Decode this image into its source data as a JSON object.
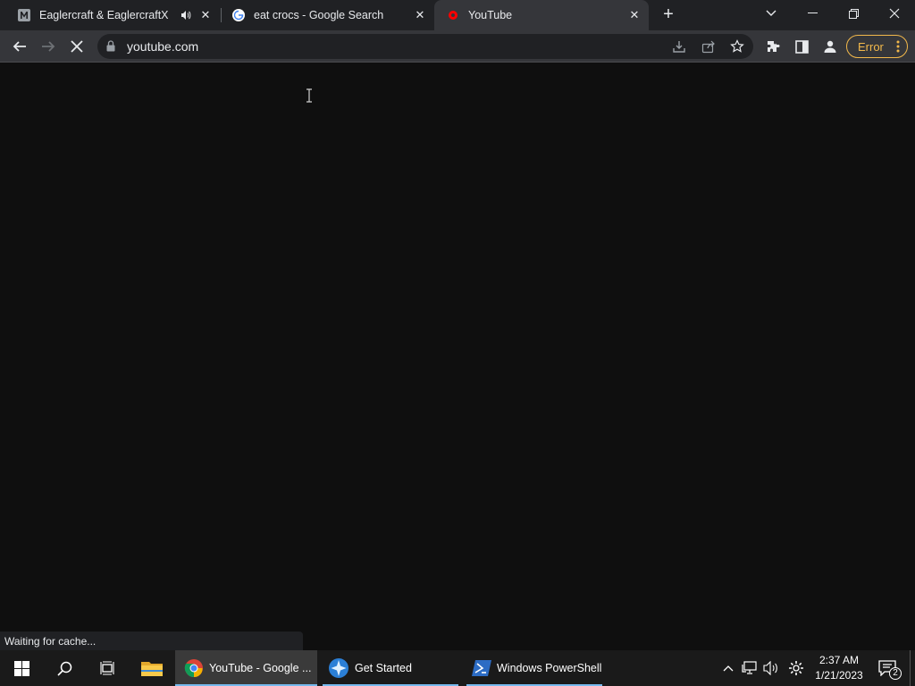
{
  "tabs": [
    {
      "title": "Eaglercraft & EaglercraftX",
      "favicon": "m-logo-icon",
      "audio": true,
      "active": false
    },
    {
      "title": "eat crocs - Google Search",
      "favicon": "google-g-icon",
      "audio": false,
      "active": false
    },
    {
      "title": "YouTube",
      "favicon": "youtube-icon",
      "audio": false,
      "active": true
    }
  ],
  "omnibox": {
    "url": "youtube.com"
  },
  "toolbar": {
    "error_label": "Error"
  },
  "status_text": "Waiting for cache...",
  "taskbar": {
    "items": [
      {
        "label": "YouTube - Google ...",
        "icon": "chrome-icon",
        "active": true
      },
      {
        "label": "Get Started",
        "icon": "get-started-icon",
        "active": false
      },
      {
        "label": "Windows PowerShell",
        "icon": "powershell-icon",
        "active": false
      }
    ],
    "clock": {
      "time": "2:37 AM",
      "date": "1/21/2023"
    },
    "notification_count": "2"
  },
  "colors": {
    "accent": "#76b9ed",
    "error": "#f2b84b",
    "youtube": "#ff0000"
  }
}
